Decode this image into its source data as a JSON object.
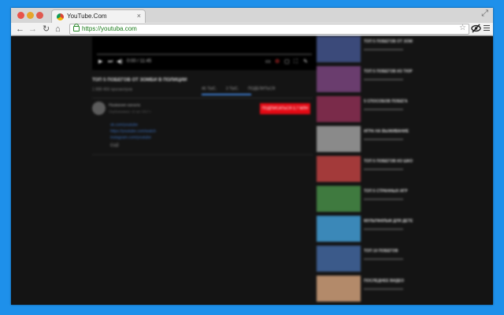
{
  "browser": {
    "tab_title": "YouTube.Com",
    "url": "https://youtuba.com",
    "tab_close_glyph": "×",
    "icons": [
      "close-dot",
      "minimize-dot",
      "maximize-dot",
      "favicon-icon",
      "resize-icon",
      "back-icon",
      "forward-icon",
      "reload-icon",
      "home-icon",
      "lock-icon",
      "star-icon",
      "hidden-eye-icon",
      "menu-icon"
    ],
    "colors": {
      "frame": "#1e90ea",
      "url_green": "#1b7c1b",
      "page_bg": "#141414"
    }
  },
  "player": {
    "time": "0:00 / 11:45",
    "progress": 0.0,
    "control_glyphs": {
      "play": "▶",
      "next": "⏭",
      "volume": "◀)"
    }
  },
  "video": {
    "title": "ТОП 5 ПОБЕГОВ ОТ ЗОМБИ В ПОЛИЦИИ",
    "views": "1 888 456 просмотров",
    "actions": {
      "like": "46 ТЫС.",
      "dislike": "3 ТЫС.",
      "share": "ПОДЕЛИТЬСЯ"
    },
    "channel_name": "Название канала",
    "published": "Опубликовано: 12 окт. 2017 г.",
    "subscribe_label": "ПОДПИСАТЬСЯ 3,7 МЛН",
    "description_links": [
      "vk.com/youtube",
      "https://youtube.com/watch",
      "instagram.com/youtube"
    ],
    "description_more": "ЕЩЁ"
  },
  "sidebar": {
    "items": [
      {
        "title": "ТОП 5 ПОБЕГОВ ОТ ЗОМБИ",
        "thumb": "#3b4a7a"
      },
      {
        "title": "ТОП 5 ПОБЕГОВ ИЗ ТЮРЬМЫ",
        "thumb": "#6a3d6e"
      },
      {
        "title": "5 СПОСОБОВ ПОБЕГА",
        "thumb": "#7a2b4a"
      },
      {
        "title": "ИГРА НА ВЫЖИВАНИЕ",
        "thumb": "#8a8a8a"
      },
      {
        "title": "ТОП 5 ПОБЕГОВ ИЗ ШКОЛЫ",
        "thumb": "#a33a3a"
      },
      {
        "title": "ТОП 5 СТРАННЫХ ИГР",
        "thumb": "#3f7a3f"
      },
      {
        "title": "МУЛЬТФИЛЬМ ДЛЯ ДЕТЕЙ",
        "thumb": "#3b88b8"
      },
      {
        "title": "ТОП 10 ПОБЕГОВ",
        "thumb": "#3b5a8a"
      },
      {
        "title": "ПОСЛЕДНЕЕ ВИДЕО",
        "thumb": "#b38a6a"
      }
    ]
  }
}
